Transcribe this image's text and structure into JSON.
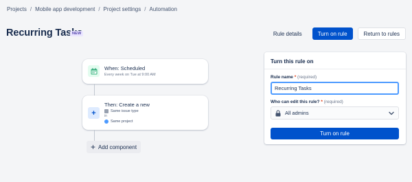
{
  "breadcrumb": {
    "items": [
      "Projects",
      "Mobile app development",
      "Project settings",
      "Automation"
    ],
    "separator": "/"
  },
  "page": {
    "title": "Recurring Tasks",
    "badge": "NEW"
  },
  "header_actions": {
    "rule_details": "Rule details",
    "turn_on_rule": "Turn on rule",
    "return_to_rules": "Return to rules"
  },
  "trigger_card": {
    "title": "When: Scheduled",
    "subtitle": "Every week on Tue at 9:00 AM",
    "icon": "calendar-icon"
  },
  "action_card": {
    "title": "Then: Create a new",
    "issue_type": "Same issue type",
    "in_label": "in",
    "project": "Same project",
    "icon": "plus-icon"
  },
  "add_component": {
    "label": "Add component"
  },
  "panel": {
    "title": "Turn this rule on",
    "rule_name_label": "Rule name",
    "required_mark": "*",
    "required_hint": "(required)",
    "rule_name_value": "Recurring Tasks",
    "who_can_edit_label": "Who can edit this rule?",
    "who_can_edit_value": "All admins",
    "submit_label": "Turn on rule"
  },
  "colors": {
    "primary": "#0052cc",
    "badge_text": "#5243aa",
    "badge_bg": "#eae6ff",
    "focus_border": "#4c9aff",
    "trigger_icon_bg": "#e3fcef",
    "action_icon_bg": "#deebff"
  }
}
